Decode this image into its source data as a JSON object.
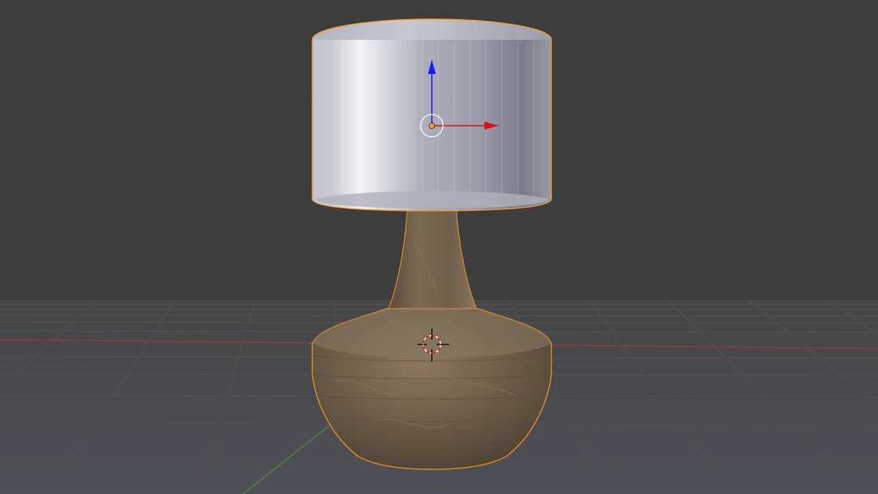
{
  "viewport": {
    "background_color": "#3d3d3d",
    "grid_color": "#4a4a4a",
    "x_axis_color": "#9a3a3a",
    "y_axis_color": "#4f8a3a"
  },
  "scene": {
    "lampshade": {
      "icon": "cylinder-mesh",
      "selected": true,
      "selection_outline_color": "#f0a030",
      "base_color": "#b8b8c4"
    },
    "lamp_base": {
      "icon": "textured-vase-mesh",
      "selected": true,
      "selection_outline_color": "#d08a30",
      "base_color": "#7a6a55"
    },
    "transform_gizmo": {
      "icon": "move-manipulator",
      "z_axis_color": "#1a1aff",
      "x_axis_color": "#e01010",
      "origin_color": "#f0a030"
    },
    "cursor_3d": {
      "icon": "3d-cursor-crosshair"
    }
  }
}
